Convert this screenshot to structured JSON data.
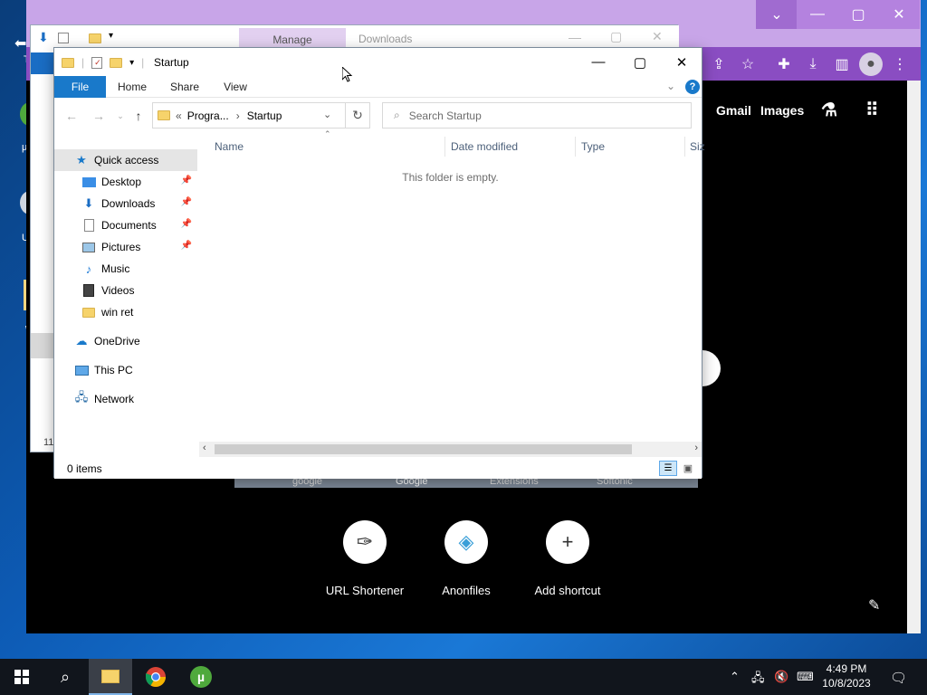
{
  "desktop": {
    "icons": [
      {
        "label": "Th"
      },
      {
        "label": "µT"
      },
      {
        "label": "UI"
      },
      {
        "label": "w"
      }
    ]
  },
  "chrome": {
    "header_links": [
      "Gmail",
      "Images"
    ],
    "shortcuts": [
      {
        "label": "URL Shortener",
        "icon": "shortener-icon"
      },
      {
        "label": "Anonfiles",
        "icon": "anonfiles-icon"
      },
      {
        "label": "Add shortcut",
        "icon": "plus-icon"
      }
    ],
    "tiles_strip": [
      "google",
      "Google",
      "Extensions",
      "Softonic"
    ],
    "accent": "#8a4dc2"
  },
  "downloads_window": {
    "title_partial": "Downloads",
    "manage_tab": "Manage",
    "status_partial": "11"
  },
  "explorer": {
    "title": "Startup",
    "ribbon_tabs": [
      "File",
      "Home",
      "Share",
      "View"
    ],
    "address": {
      "prefix": "«",
      "crumbs": [
        "Progra...",
        "Startup"
      ]
    },
    "search_placeholder": "Search Startup",
    "nav": [
      {
        "label": "Quick access",
        "icon": "star-icon",
        "pinned": false,
        "selected": true
      },
      {
        "label": "Desktop",
        "icon": "desktop-folder-icon",
        "pinned": true
      },
      {
        "label": "Downloads",
        "icon": "download-folder-icon",
        "pinned": true
      },
      {
        "label": "Documents",
        "icon": "documents-folder-icon",
        "pinned": true
      },
      {
        "label": "Pictures",
        "icon": "pictures-folder-icon",
        "pinned": true
      },
      {
        "label": "Music",
        "icon": "music-folder-icon",
        "pinned": false
      },
      {
        "label": "Videos",
        "icon": "videos-folder-icon",
        "pinned": false
      },
      {
        "label": "win ret",
        "icon": "folder-icon",
        "pinned": false
      },
      {
        "label": "OneDrive",
        "icon": "onedrive-icon",
        "pinned": false
      },
      {
        "label": "This PC",
        "icon": "this-pc-icon",
        "pinned": false
      },
      {
        "label": "Network",
        "icon": "network-icon",
        "pinned": false
      }
    ],
    "columns": [
      "Name",
      "Date modified",
      "Type",
      "Siz"
    ],
    "empty_message": "This folder is empty.",
    "status": "0 items"
  },
  "taskbar": {
    "time": "4:49 PM",
    "date": "10/8/2023"
  }
}
